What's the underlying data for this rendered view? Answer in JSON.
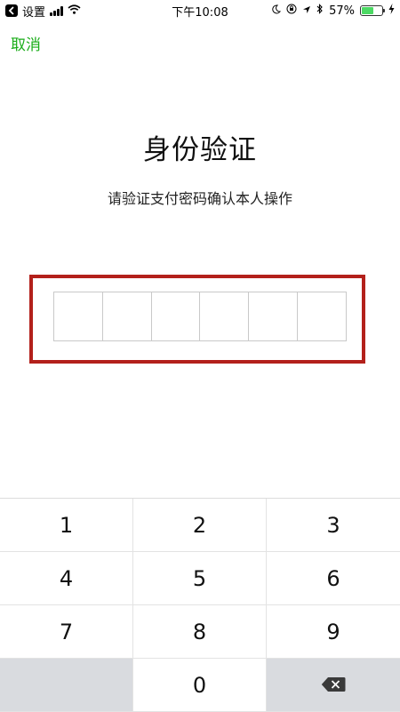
{
  "status_bar": {
    "back_app": "设置",
    "time": "下午10:08",
    "battery_percent": "57%",
    "battery_level": 0.57,
    "icons": [
      "back-arrow-icon",
      "signal-icon",
      "wifi-icon",
      "moon-icon",
      "orientation-lock-icon",
      "location-icon",
      "bluetooth-icon",
      "battery-icon",
      "charging-icon"
    ]
  },
  "header": {
    "cancel_label": "取消"
  },
  "main": {
    "title": "身份验证",
    "subtitle": "请验证支付密码确认本人操作",
    "pin_length": 6
  },
  "keypad": {
    "keys": [
      "1",
      "2",
      "3",
      "4",
      "5",
      "6",
      "7",
      "8",
      "9",
      "",
      "0",
      "delete-icon"
    ]
  },
  "colors": {
    "accent": "#1aad19",
    "highlight_border": "#b3201b",
    "battery": "#4cd964",
    "key_gray": "#d9dbdf"
  }
}
